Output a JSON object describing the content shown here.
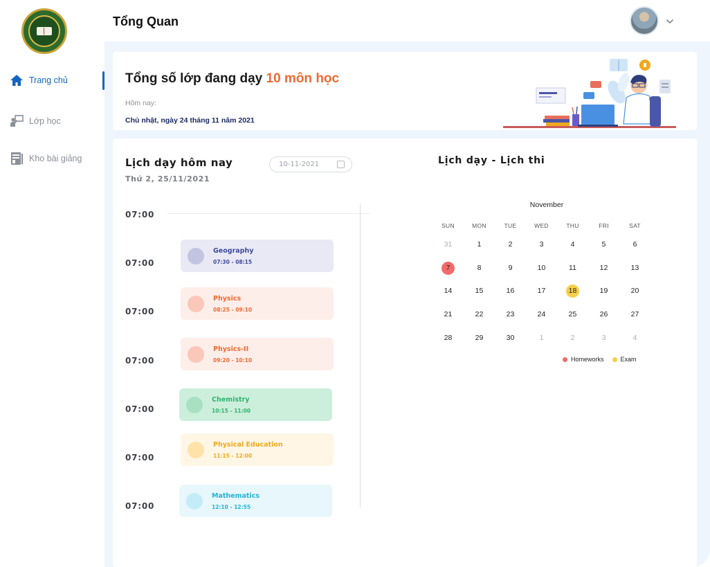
{
  "header": {
    "title": "Tổng Quan"
  },
  "sidebar": {
    "items": [
      {
        "label": "Trang chủ",
        "active": true,
        "icon": "home-icon"
      },
      {
        "label": "Lớp học",
        "active": false,
        "icon": "classroom-icon"
      },
      {
        "label": "Kho bài giảng",
        "active": false,
        "icon": "lecture-library-icon"
      }
    ]
  },
  "banner": {
    "heading": "Tổng số lớp đang dạy",
    "highlight": "10 môn học",
    "today_label": "Hôm nay:",
    "date_text": "Chủ nhật, ngày 24 tháng 11 năm 2021"
  },
  "schedule": {
    "title": "Lịch dạy hôm nay",
    "subtitle": "Thứ 2, 25/11/2021",
    "date_value": "10-11-2021",
    "time_labels": [
      "07:00",
      "07:00",
      "07:00",
      "07:00",
      "07:00",
      "07:00",
      "07:00"
    ],
    "events": [
      {
        "name": "Geography",
        "time": "07:30 - 08:15",
        "bg": "#e9e9f5",
        "dot": "#c3c3e2",
        "color": "#3f4a9c"
      },
      {
        "name": "Physics",
        "time": "08:25 - 09:10",
        "bg": "#fdeeea",
        "dot": "#fbc7b9",
        "color": "#f2692e"
      },
      {
        "name": "Physics-II",
        "time": "09:20 - 10:10",
        "bg": "#fdeeea",
        "dot": "#fbc7b9",
        "color": "#f2692e"
      },
      {
        "name": "Chemistry",
        "time": "10:15 - 11:00",
        "bg": "#ccefdc",
        "dot": "#a9e0c2",
        "color": "#2fb36b"
      },
      {
        "name": "Physical Education",
        "time": "11:15 - 12:00",
        "bg": "#fff6e6",
        "dot": "#ffe2a8",
        "color": "#f0a81c"
      },
      {
        "name": "Mathematics",
        "time": "12:10 - 12:55",
        "bg": "#e8f7fc",
        "dot": "#c4ecf8",
        "color": "#22b3d6"
      }
    ]
  },
  "calendar": {
    "title": "Lịch dạy - Lịch thi",
    "month": "November",
    "weekdays": [
      "SUN",
      "MON",
      "TUE",
      "WED",
      "THU",
      "FRI",
      "SAT"
    ],
    "weeks": [
      [
        "31",
        "1",
        "2",
        "3",
        "4",
        "5",
        "6"
      ],
      [
        "7",
        "8",
        "9",
        "10",
        "11",
        "12",
        "13"
      ],
      [
        "14",
        "15",
        "16",
        "17",
        "18",
        "19",
        "20"
      ],
      [
        "21",
        "22",
        "23",
        "24",
        "25",
        "26",
        "27"
      ],
      [
        "28",
        "29",
        "30",
        "1",
        "2",
        "3",
        "4"
      ]
    ],
    "muted": [
      [
        0,
        0
      ],
      [
        4,
        3
      ],
      [
        4,
        4
      ],
      [
        4,
        5
      ],
      [
        4,
        6
      ]
    ],
    "homework_days": [
      [
        1,
        0
      ]
    ],
    "exam_days": [
      [
        2,
        4
      ]
    ],
    "homework_color": "#f26b6b",
    "exam_color": "#f7cf4a",
    "legend": {
      "homeworks": "Homeworks",
      "exam": "Exam"
    }
  }
}
